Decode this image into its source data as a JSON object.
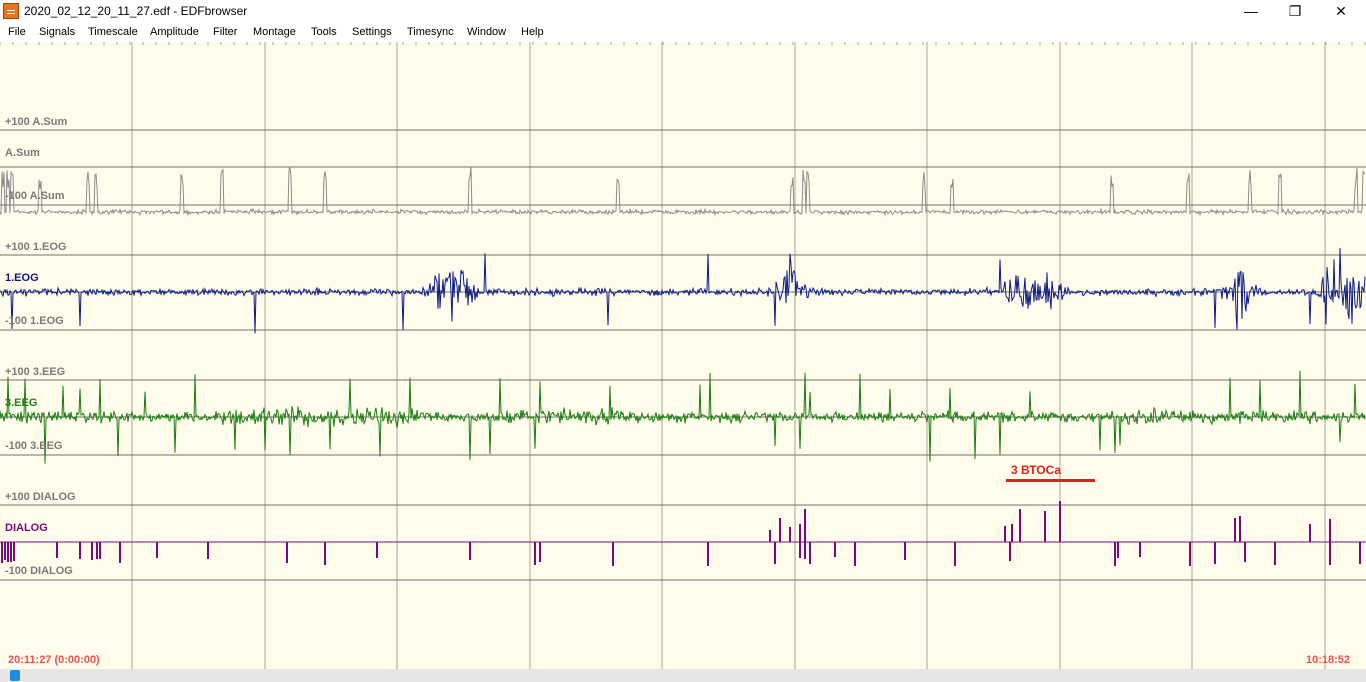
{
  "window": {
    "title": "2020_02_12_20_11_27.edf - EDFbrowser",
    "minimize": "—",
    "maximize": "❐",
    "close": "✕"
  },
  "menu": [
    "File",
    "Signals",
    "Timescale",
    "Amplitude",
    "Filter",
    "Montage",
    "Tools",
    "Settings",
    "Timesync",
    "Window",
    "Help"
  ],
  "colors": {
    "background": "#fffcec",
    "grid": "#a8a890",
    "baseline": "#707070",
    "asum": "#8c8c8c",
    "eog": "#0b1b86",
    "eeg": "#1a7d10",
    "dialog": "#7a0a7a",
    "annotation": "#e02020",
    "time": "#f05050"
  },
  "signals": [
    {
      "id": "asum",
      "name": "A.Sum",
      "top_label": "+100 A.Sum",
      "bottom_label": "-100 A.Sum",
      "color": "#8c8c8c"
    },
    {
      "id": "eog",
      "name": "1.EOG",
      "top_label": "+100 1.EOG",
      "bottom_label": "-100 1.EOG",
      "color": "#0b1b86"
    },
    {
      "id": "eeg",
      "name": "3.EEG",
      "top_label": "+100 3.EEG",
      "bottom_label": "-100 3.EEG",
      "color": "#1a7d10"
    },
    {
      "id": "dialog",
      "name": "DIALOG",
      "top_label": "+100 DIALOG",
      "bottom_label": "-100 DIALOG",
      "color": "#7a0a7a"
    }
  ],
  "annotation": {
    "text": "3 ВТОСа"
  },
  "time": {
    "start": "20:11:27 (0:00:00)",
    "end": "10:18:52"
  }
}
